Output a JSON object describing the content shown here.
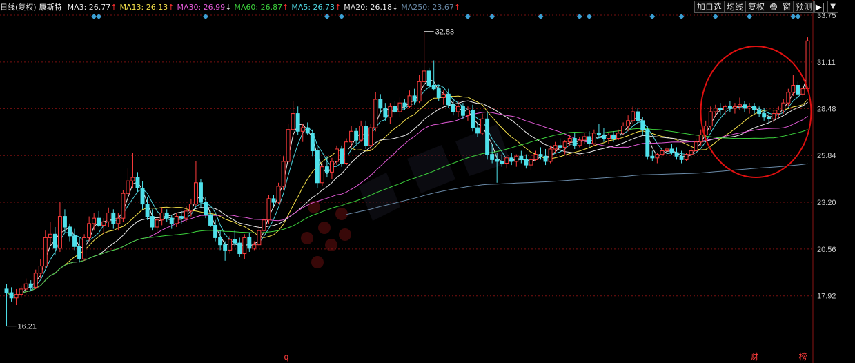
{
  "header": {
    "period_label": "日线(复权)",
    "stock_name": "康斯特",
    "ma_indicators": [
      {
        "label": "MA3: 26.77",
        "arrow": "↑",
        "color": "#e8e8e8"
      },
      {
        "label": "MA13: 26.13",
        "arrow": "↑",
        "color": "#f4e04a"
      },
      {
        "label": "MA30: 26.99",
        "arrow": "↓",
        "color": "#e35ad8"
      },
      {
        "label": "MA60: 26.87",
        "arrow": "↑",
        "color": "#3cd13c"
      },
      {
        "label": "MA5: 26.73",
        "arrow": "↑",
        "color": "#4fd4e0"
      },
      {
        "label": "MA20: 26.18",
        "arrow": "↓",
        "color": "#e8e8e8"
      },
      {
        "label": "MA250: 23.67",
        "arrow": "↑",
        "color": "#6a8aa8"
      }
    ],
    "up_arrow_color": "#ff3030",
    "down_arrow_color": "#e8e8e8"
  },
  "toolbar": {
    "buttons": [
      "加自选",
      "均线",
      "复权",
      "叠",
      "窗",
      "预测"
    ],
    "nav_icon": "collapse-right-icon",
    "dropdown_icon": "chevron-down-icon"
  },
  "colors": {
    "up": "#ff3c3c",
    "down": "#4fe0ea",
    "grid": "#7a1010",
    "axis_text": "#cccccc",
    "circle": "#e01010",
    "event_marker": "#3b9fd4"
  },
  "markers": {
    "bottom": [
      {
        "label": "q",
        "color": "#ff3c3c"
      },
      {
        "label": "财",
        "color": "#ff3c3c"
      },
      {
        "label": "榜",
        "color": "#ff3c3c"
      }
    ],
    "watermark_icon": "stock-app-logo-watermark"
  },
  "chart_data": {
    "type": "candlestick",
    "title": "康斯特",
    "y_ticks": [
      17.92,
      20.56,
      23.2,
      25.84,
      28.48,
      31.11,
      33.75
    ],
    "ylim": [
      15.3,
      33.75
    ],
    "grid": true,
    "annotations": [
      {
        "text": "32.83",
        "type": "high",
        "candle_index": 86
      },
      {
        "text": "16.21",
        "type": "low",
        "candle_index": 0
      }
    ],
    "candles": [
      {
        "o": 18.3,
        "h": 18.6,
        "l": 16.21,
        "c": 18.1
      },
      {
        "o": 18.1,
        "h": 18.4,
        "l": 17.6,
        "c": 17.8
      },
      {
        "o": 17.8,
        "h": 18.3,
        "l": 17.4,
        "c": 18.0
      },
      {
        "o": 18.0,
        "h": 18.5,
        "l": 17.8,
        "c": 18.3
      },
      {
        "o": 18.3,
        "h": 18.9,
        "l": 18.0,
        "c": 18.6
      },
      {
        "o": 18.6,
        "h": 18.8,
        "l": 18.2,
        "c": 18.4
      },
      {
        "o": 18.4,
        "h": 19.4,
        "l": 18.3,
        "c": 19.2
      },
      {
        "o": 19.2,
        "h": 20.0,
        "l": 18.9,
        "c": 19.6
      },
      {
        "o": 19.6,
        "h": 21.6,
        "l": 19.5,
        "c": 21.2
      },
      {
        "o": 21.2,
        "h": 22.1,
        "l": 20.8,
        "c": 21.4
      },
      {
        "o": 21.4,
        "h": 21.8,
        "l": 20.2,
        "c": 20.6
      },
      {
        "o": 20.6,
        "h": 23.2,
        "l": 20.4,
        "c": 22.4
      },
      {
        "o": 22.4,
        "h": 22.8,
        "l": 21.5,
        "c": 21.8
      },
      {
        "o": 21.8,
        "h": 22.0,
        "l": 21.0,
        "c": 21.3
      },
      {
        "o": 21.3,
        "h": 21.7,
        "l": 20.5,
        "c": 20.7
      },
      {
        "o": 20.7,
        "h": 21.2,
        "l": 19.8,
        "c": 20.0
      },
      {
        "o": 20.0,
        "h": 21.4,
        "l": 19.9,
        "c": 21.2
      },
      {
        "o": 21.2,
        "h": 22.4,
        "l": 21.0,
        "c": 22.0
      },
      {
        "o": 22.0,
        "h": 22.6,
        "l": 21.6,
        "c": 22.3
      },
      {
        "o": 22.3,
        "h": 22.7,
        "l": 21.8,
        "c": 21.9
      },
      {
        "o": 21.9,
        "h": 22.3,
        "l": 21.4,
        "c": 22.1
      },
      {
        "o": 22.1,
        "h": 22.9,
        "l": 21.8,
        "c": 22.6
      },
      {
        "o": 22.6,
        "h": 22.8,
        "l": 21.7,
        "c": 22.0
      },
      {
        "o": 22.0,
        "h": 22.6,
        "l": 21.6,
        "c": 22.3
      },
      {
        "o": 22.3,
        "h": 23.9,
        "l": 22.1,
        "c": 23.7
      },
      {
        "o": 23.7,
        "h": 25.1,
        "l": 23.4,
        "c": 24.4
      },
      {
        "o": 24.4,
        "h": 26.0,
        "l": 24.0,
        "c": 24.6
      },
      {
        "o": 24.6,
        "h": 24.9,
        "l": 23.8,
        "c": 24.0
      },
      {
        "o": 24.0,
        "h": 24.4,
        "l": 22.8,
        "c": 23.1
      },
      {
        "o": 23.1,
        "h": 23.5,
        "l": 22.2,
        "c": 22.4
      },
      {
        "o": 22.4,
        "h": 22.8,
        "l": 21.6,
        "c": 21.8
      },
      {
        "o": 21.8,
        "h": 22.4,
        "l": 21.4,
        "c": 22.2
      },
      {
        "o": 22.2,
        "h": 22.9,
        "l": 21.9,
        "c": 22.6
      },
      {
        "o": 22.6,
        "h": 22.8,
        "l": 22.1,
        "c": 22.3
      },
      {
        "o": 22.3,
        "h": 22.5,
        "l": 21.7,
        "c": 22.0
      },
      {
        "o": 22.0,
        "h": 22.6,
        "l": 21.8,
        "c": 22.4
      },
      {
        "o": 22.4,
        "h": 22.7,
        "l": 22.0,
        "c": 22.3
      },
      {
        "o": 22.3,
        "h": 23.0,
        "l": 22.1,
        "c": 22.7
      },
      {
        "o": 22.7,
        "h": 23.4,
        "l": 22.4,
        "c": 23.1
      },
      {
        "o": 23.1,
        "h": 25.5,
        "l": 23.0,
        "c": 24.3
      },
      {
        "o": 24.3,
        "h": 24.5,
        "l": 22.9,
        "c": 23.2
      },
      {
        "o": 23.2,
        "h": 23.5,
        "l": 22.3,
        "c": 22.5
      },
      {
        "o": 22.5,
        "h": 22.7,
        "l": 21.8,
        "c": 21.9
      },
      {
        "o": 21.9,
        "h": 22.2,
        "l": 21.0,
        "c": 21.2
      },
      {
        "o": 21.2,
        "h": 21.6,
        "l": 20.5,
        "c": 20.8
      },
      {
        "o": 20.8,
        "h": 21.0,
        "l": 19.9,
        "c": 20.5
      },
      {
        "o": 20.5,
        "h": 21.3,
        "l": 20.3,
        "c": 21.1
      },
      {
        "o": 21.1,
        "h": 21.6,
        "l": 20.7,
        "c": 20.9
      },
      {
        "o": 20.9,
        "h": 21.2,
        "l": 20.1,
        "c": 20.3
      },
      {
        "o": 20.3,
        "h": 21.4,
        "l": 20.0,
        "c": 21.2
      },
      {
        "o": 21.2,
        "h": 21.5,
        "l": 20.4,
        "c": 20.6
      },
      {
        "o": 20.6,
        "h": 21.0,
        "l": 20.5,
        "c": 20.8
      },
      {
        "o": 20.8,
        "h": 21.9,
        "l": 20.7,
        "c": 21.6
      },
      {
        "o": 21.6,
        "h": 22.4,
        "l": 21.4,
        "c": 22.2
      },
      {
        "o": 22.2,
        "h": 23.6,
        "l": 22.0,
        "c": 23.4
      },
      {
        "o": 23.4,
        "h": 23.6,
        "l": 23.0,
        "c": 23.2
      },
      {
        "o": 23.2,
        "h": 24.3,
        "l": 23.1,
        "c": 24.1
      },
      {
        "o": 24.1,
        "h": 25.8,
        "l": 23.9,
        "c": 25.5
      },
      {
        "o": 25.5,
        "h": 27.6,
        "l": 25.4,
        "c": 27.3
      },
      {
        "o": 27.3,
        "h": 28.9,
        "l": 26.8,
        "c": 28.2
      },
      {
        "o": 28.2,
        "h": 28.6,
        "l": 27.0,
        "c": 27.2
      },
      {
        "o": 27.2,
        "h": 27.6,
        "l": 26.6,
        "c": 27.4
      },
      {
        "o": 27.4,
        "h": 27.7,
        "l": 27.0,
        "c": 27.1
      },
      {
        "o": 27.1,
        "h": 27.3,
        "l": 25.8,
        "c": 26.1
      },
      {
        "o": 26.1,
        "h": 26.3,
        "l": 24.0,
        "c": 24.3
      },
      {
        "o": 24.3,
        "h": 25.4,
        "l": 24.1,
        "c": 25.2
      },
      {
        "o": 25.2,
        "h": 25.8,
        "l": 24.6,
        "c": 24.9
      },
      {
        "o": 24.9,
        "h": 25.7,
        "l": 24.5,
        "c": 25.5
      },
      {
        "o": 25.5,
        "h": 26.4,
        "l": 25.3,
        "c": 26.2
      },
      {
        "o": 26.2,
        "h": 26.4,
        "l": 25.2,
        "c": 25.4
      },
      {
        "o": 25.4,
        "h": 26.8,
        "l": 25.3,
        "c": 26.6
      },
      {
        "o": 26.6,
        "h": 27.5,
        "l": 26.3,
        "c": 27.2
      },
      {
        "o": 27.2,
        "h": 27.4,
        "l": 26.5,
        "c": 26.7
      },
      {
        "o": 26.7,
        "h": 27.8,
        "l": 26.6,
        "c": 27.5
      },
      {
        "o": 27.5,
        "h": 27.8,
        "l": 26.2,
        "c": 26.4
      },
      {
        "o": 26.4,
        "h": 27.6,
        "l": 26.1,
        "c": 27.4
      },
      {
        "o": 27.4,
        "h": 29.4,
        "l": 27.2,
        "c": 29.0
      },
      {
        "o": 29.0,
        "h": 29.3,
        "l": 28.2,
        "c": 28.5
      },
      {
        "o": 28.5,
        "h": 28.8,
        "l": 27.8,
        "c": 28.0
      },
      {
        "o": 28.0,
        "h": 28.8,
        "l": 27.6,
        "c": 28.6
      },
      {
        "o": 28.6,
        "h": 28.9,
        "l": 28.2,
        "c": 28.3
      },
      {
        "o": 28.3,
        "h": 29.1,
        "l": 28.0,
        "c": 28.8
      },
      {
        "o": 28.8,
        "h": 29.0,
        "l": 28.4,
        "c": 28.6
      },
      {
        "o": 28.6,
        "h": 29.5,
        "l": 28.5,
        "c": 29.2
      },
      {
        "o": 29.2,
        "h": 29.6,
        "l": 28.7,
        "c": 28.9
      },
      {
        "o": 28.9,
        "h": 30.4,
        "l": 28.8,
        "c": 30.0
      },
      {
        "o": 30.0,
        "h": 32.83,
        "l": 29.8,
        "c": 30.6
      },
      {
        "o": 30.6,
        "h": 30.8,
        "l": 29.6,
        "c": 29.8
      },
      {
        "o": 29.8,
        "h": 31.2,
        "l": 29.5,
        "c": 29.6
      },
      {
        "o": 29.6,
        "h": 29.8,
        "l": 28.9,
        "c": 29.1
      },
      {
        "o": 29.1,
        "h": 29.5,
        "l": 28.7,
        "c": 29.3
      },
      {
        "o": 29.3,
        "h": 29.6,
        "l": 28.5,
        "c": 28.7
      },
      {
        "o": 28.7,
        "h": 29.0,
        "l": 28.1,
        "c": 28.3
      },
      {
        "o": 28.3,
        "h": 28.9,
        "l": 28.0,
        "c": 28.6
      },
      {
        "o": 28.6,
        "h": 28.8,
        "l": 27.9,
        "c": 28.1
      },
      {
        "o": 28.1,
        "h": 28.6,
        "l": 27.8,
        "c": 28.4
      },
      {
        "o": 28.4,
        "h": 28.7,
        "l": 27.2,
        "c": 27.4
      },
      {
        "o": 27.4,
        "h": 27.7,
        "l": 26.9,
        "c": 27.1
      },
      {
        "o": 27.1,
        "h": 28.2,
        "l": 27.0,
        "c": 27.9
      },
      {
        "o": 27.9,
        "h": 28.3,
        "l": 25.6,
        "c": 25.9
      },
      {
        "o": 25.9,
        "h": 26.5,
        "l": 25.4,
        "c": 25.6
      },
      {
        "o": 25.6,
        "h": 26.0,
        "l": 24.3,
        "c": 25.5
      },
      {
        "o": 25.5,
        "h": 25.9,
        "l": 25.2,
        "c": 25.4
      },
      {
        "o": 25.4,
        "h": 25.8,
        "l": 25.1,
        "c": 25.7
      },
      {
        "o": 25.7,
        "h": 26.0,
        "l": 25.3,
        "c": 25.5
      },
      {
        "o": 25.5,
        "h": 25.9,
        "l": 25.2,
        "c": 25.8
      },
      {
        "o": 25.8,
        "h": 26.1,
        "l": 25.4,
        "c": 25.6
      },
      {
        "o": 25.6,
        "h": 25.9,
        "l": 25.1,
        "c": 25.3
      },
      {
        "o": 25.3,
        "h": 25.8,
        "l": 25.0,
        "c": 25.6
      },
      {
        "o": 25.6,
        "h": 26.1,
        "l": 25.5,
        "c": 25.9
      },
      {
        "o": 25.9,
        "h": 26.3,
        "l": 25.6,
        "c": 25.8
      },
      {
        "o": 25.8,
        "h": 26.2,
        "l": 25.3,
        "c": 25.5
      },
      {
        "o": 25.5,
        "h": 26.4,
        "l": 25.4,
        "c": 26.2
      },
      {
        "o": 26.2,
        "h": 26.6,
        "l": 26.0,
        "c": 26.4
      },
      {
        "o": 26.4,
        "h": 26.8,
        "l": 26.1,
        "c": 26.3
      },
      {
        "o": 26.3,
        "h": 26.7,
        "l": 25.9,
        "c": 26.6
      },
      {
        "o": 26.6,
        "h": 27.0,
        "l": 26.4,
        "c": 26.8
      },
      {
        "o": 26.8,
        "h": 27.1,
        "l": 26.2,
        "c": 26.4
      },
      {
        "o": 26.4,
        "h": 26.9,
        "l": 26.3,
        "c": 26.7
      },
      {
        "o": 26.7,
        "h": 27.1,
        "l": 26.5,
        "c": 26.9
      },
      {
        "o": 26.9,
        "h": 27.2,
        "l": 26.3,
        "c": 26.5
      },
      {
        "o": 26.5,
        "h": 27.3,
        "l": 26.4,
        "c": 27.1
      },
      {
        "o": 27.1,
        "h": 27.6,
        "l": 26.8,
        "c": 27.0
      },
      {
        "o": 27.0,
        "h": 27.4,
        "l": 26.6,
        "c": 26.8
      },
      {
        "o": 26.8,
        "h": 27.1,
        "l": 26.5,
        "c": 27.0
      },
      {
        "o": 27.0,
        "h": 27.2,
        "l": 26.6,
        "c": 26.8
      },
      {
        "o": 26.8,
        "h": 27.3,
        "l": 26.7,
        "c": 27.1
      },
      {
        "o": 27.1,
        "h": 27.7,
        "l": 27.0,
        "c": 27.5
      },
      {
        "o": 27.5,
        "h": 28.1,
        "l": 27.2,
        "c": 27.8
      },
      {
        "o": 27.8,
        "h": 28.6,
        "l": 27.6,
        "c": 28.3
      },
      {
        "o": 28.3,
        "h": 28.5,
        "l": 27.6,
        "c": 27.8
      },
      {
        "o": 27.8,
        "h": 28.0,
        "l": 27.0,
        "c": 27.3
      },
      {
        "o": 27.3,
        "h": 27.5,
        "l": 25.6,
        "c": 25.8
      },
      {
        "o": 25.8,
        "h": 26.1,
        "l": 25.5,
        "c": 25.7
      },
      {
        "o": 25.7,
        "h": 26.0,
        "l": 25.4,
        "c": 25.9
      },
      {
        "o": 25.9,
        "h": 26.3,
        "l": 25.7,
        "c": 26.1
      },
      {
        "o": 26.1,
        "h": 26.4,
        "l": 25.9,
        "c": 26.2
      },
      {
        "o": 26.2,
        "h": 26.5,
        "l": 25.9,
        "c": 26.0
      },
      {
        "o": 26.0,
        "h": 26.3,
        "l": 25.6,
        "c": 25.8
      },
      {
        "o": 25.8,
        "h": 26.1,
        "l": 25.4,
        "c": 25.6
      },
      {
        "o": 25.6,
        "h": 26.0,
        "l": 25.5,
        "c": 25.9
      },
      {
        "o": 25.9,
        "h": 26.3,
        "l": 25.7,
        "c": 26.1
      },
      {
        "o": 26.1,
        "h": 26.8,
        "l": 26.0,
        "c": 26.6
      },
      {
        "o": 26.6,
        "h": 27.3,
        "l": 26.4,
        "c": 27.0
      },
      {
        "o": 27.0,
        "h": 27.8,
        "l": 26.9,
        "c": 27.5
      },
      {
        "o": 27.5,
        "h": 28.6,
        "l": 27.3,
        "c": 28.3
      },
      {
        "o": 28.3,
        "h": 28.7,
        "l": 28.0,
        "c": 28.5
      },
      {
        "o": 28.5,
        "h": 28.8,
        "l": 28.1,
        "c": 28.4
      },
      {
        "o": 28.4,
        "h": 28.7,
        "l": 28.1,
        "c": 28.6
      },
      {
        "o": 28.6,
        "h": 28.9,
        "l": 28.3,
        "c": 28.5
      },
      {
        "o": 28.5,
        "h": 28.8,
        "l": 28.2,
        "c": 28.6
      },
      {
        "o": 28.6,
        "h": 29.1,
        "l": 28.4,
        "c": 28.7
      },
      {
        "o": 28.7,
        "h": 28.9,
        "l": 28.3,
        "c": 28.5
      },
      {
        "o": 28.5,
        "h": 28.8,
        "l": 28.2,
        "c": 28.6
      },
      {
        "o": 28.6,
        "h": 28.8,
        "l": 28.2,
        "c": 28.4
      },
      {
        "o": 28.4,
        "h": 28.6,
        "l": 28.0,
        "c": 28.2
      },
      {
        "o": 28.2,
        "h": 28.5,
        "l": 27.8,
        "c": 28.0
      },
      {
        "o": 28.0,
        "h": 28.3,
        "l": 27.6,
        "c": 27.9
      },
      {
        "o": 27.9,
        "h": 28.4,
        "l": 27.7,
        "c": 28.2
      },
      {
        "o": 28.2,
        "h": 28.6,
        "l": 28.0,
        "c": 28.4
      },
      {
        "o": 28.4,
        "h": 29.0,
        "l": 28.2,
        "c": 28.8
      },
      {
        "o": 28.8,
        "h": 29.6,
        "l": 28.6,
        "c": 29.4
      },
      {
        "o": 29.4,
        "h": 30.4,
        "l": 29.2,
        "c": 29.8
      },
      {
        "o": 29.8,
        "h": 30.0,
        "l": 29.0,
        "c": 29.3
      },
      {
        "o": 29.3,
        "h": 29.8,
        "l": 29.1,
        "c": 29.6
      },
      {
        "o": 29.6,
        "h": 32.5,
        "l": 29.5,
        "c": 32.3
      }
    ]
  }
}
